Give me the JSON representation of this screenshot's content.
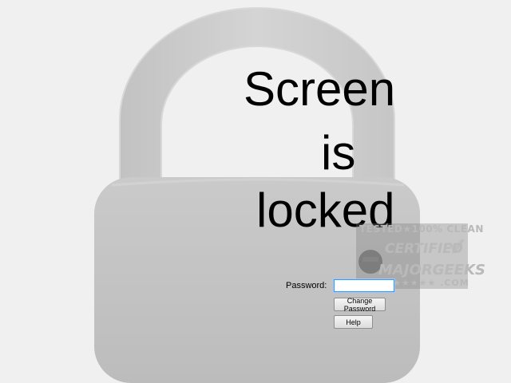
{
  "lock_screen": {
    "title_lines": [
      "Screen",
      "is",
      "locked"
    ],
    "password_label": "Password:",
    "password_value": "",
    "change_password_label": "Change Password",
    "help_label": "Help"
  },
  "watermark": {
    "line1": "TESTED★100% CLEAN",
    "line2": "CERTIFIED",
    "line3": "MAJORGEEKS",
    "line4": "★★★★★ .COM"
  },
  "colors": {
    "background": "#f0f0f0",
    "lock_body": "#c6c6c6",
    "input_focus_border": "#3399ff"
  },
  "icons": {
    "background_art": "padlock-icon"
  }
}
